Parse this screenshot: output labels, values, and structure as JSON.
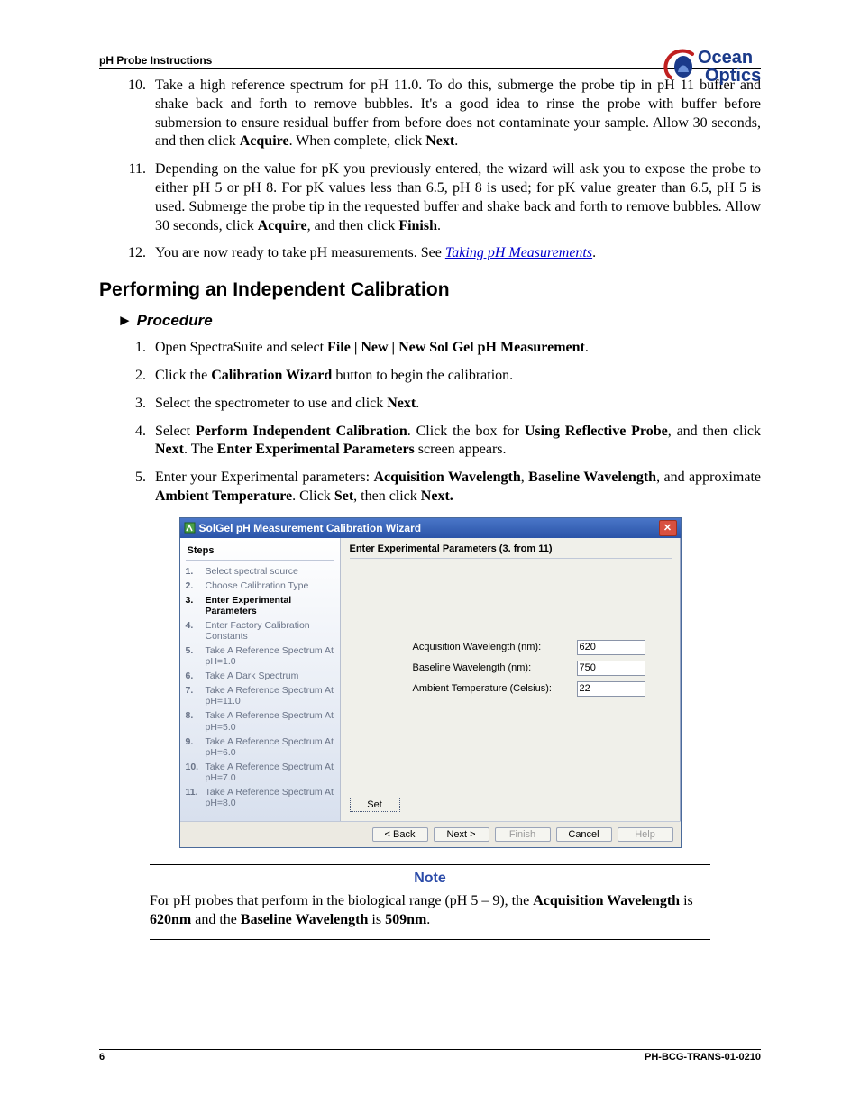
{
  "header": {
    "doc_title": "pH Probe Instructions"
  },
  "logo": {
    "line1": "Ocean",
    "line2": "Optics"
  },
  "instr_10_a": "Take a high reference spectrum for pH 11.0. To do this, submerge the probe tip in pH 11 buffer and shake back and forth to remove bubbles. It's a good idea to rinse the probe with buffer before submersion to ensure residual buffer from before does not contaminate your sample. Allow 30 seconds, and then click ",
  "instr_10_b": "Acquire",
  "instr_10_c": ". When complete, click ",
  "instr_10_d": "Next",
  "instr_10_e": ".",
  "instr_11_a": "Depending on the value for pK you previously entered, the wizard will ask you to expose the probe to either pH 5 or pH 8. For pK values less than 6.5, pH 8 is used; for pK value greater than 6.5, pH 5 is used. Submerge the probe tip in the requested buffer and shake back and forth to remove bubbles. Allow 30 seconds, click ",
  "instr_11_b": "Acquire",
  "instr_11_c": ", and then click ",
  "instr_11_d": "Finish",
  "instr_11_e": ".",
  "instr_12_a": "You are now ready to take pH measurements. See ",
  "instr_12_link": "Taking pH Measurements",
  "instr_12_b": ".",
  "section_heading": "Performing an Independent Calibration",
  "procedure_label": "Procedure",
  "proc_1_a": "Open SpectraSuite and select ",
  "proc_1_b": "File | New | New Sol Gel pH Measurement",
  "proc_1_c": ".",
  "proc_2_a": "Click the ",
  "proc_2_b": "Calibration Wizard",
  "proc_2_c": " button to begin the calibration.",
  "proc_3_a": "Select the spectrometer to use and click ",
  "proc_3_b": "Next",
  "proc_3_c": ".",
  "proc_4_a": "Select ",
  "proc_4_b": "Perform Independent Calibration",
  "proc_4_c": ". Click the box for ",
  "proc_4_d": "Using Reflective Probe",
  "proc_4_e": ", and then click ",
  "proc_4_f": "Next",
  "proc_4_g": ". The ",
  "proc_4_h": "Enter Experimental Parameters",
  "proc_4_i": " screen appears.",
  "proc_5_a": "Enter your Experimental parameters: ",
  "proc_5_b": "Acquisition Wavelength",
  "proc_5_c": ", ",
  "proc_5_d": "Baseline Wavelength",
  "proc_5_e": ", and approximate ",
  "proc_5_f": "Ambient Temperature",
  "proc_5_g": ". Click ",
  "proc_5_h": "Set",
  "proc_5_i": ", then click ",
  "proc_5_j": "Next.",
  "wizard": {
    "title": "SolGel pH Measurement Calibration Wizard",
    "steps_label": "Steps",
    "steps": [
      {
        "n": "1.",
        "t": "Select spectral source"
      },
      {
        "n": "2.",
        "t": "Choose Calibration Type"
      },
      {
        "n": "3.",
        "t": "Enter Experimental Parameters"
      },
      {
        "n": "4.",
        "t": "Enter Factory Calibration Constants"
      },
      {
        "n": "5.",
        "t": "Take A Reference Spectrum At pH=1.0"
      },
      {
        "n": "6.",
        "t": "Take A Dark Spectrum"
      },
      {
        "n": "7.",
        "t": "Take A Reference Spectrum At pH=11.0"
      },
      {
        "n": "8.",
        "t": "Take A Reference Spectrum At pH=5.0"
      },
      {
        "n": "9.",
        "t": "Take A Reference Spectrum At pH=6.0"
      },
      {
        "n": "10.",
        "t": "Take A Reference Spectrum At pH=7.0"
      },
      {
        "n": "11.",
        "t": "Take A Reference Spectrum At pH=8.0"
      }
    ],
    "main_head": "Enter Experimental Parameters (3. from 11)",
    "params": {
      "acq_label": "Acquisition Wavelength (nm):",
      "acq_value": "620",
      "base_label": "Baseline Wavelength (nm):",
      "base_value": "750",
      "temp_label": "Ambient Temperature (Celsius):",
      "temp_value": "22"
    },
    "set_button": "Set",
    "buttons": {
      "back": "< Back",
      "next": "Next >",
      "finish": "Finish",
      "cancel": "Cancel",
      "help": "Help"
    }
  },
  "note": {
    "heading": "Note",
    "a": "For pH probes that perform in the biological range (pH 5 – 9), the ",
    "b": "Acquisition Wavelength",
    "c": " is ",
    "d": "620nm",
    "e": " and the ",
    "f": "Baseline Wavelength",
    "g": " is ",
    "h": "509nm",
    "i": "."
  },
  "footer": {
    "page": "6",
    "doc_id": "PH-BCG-TRANS-01-0210"
  }
}
